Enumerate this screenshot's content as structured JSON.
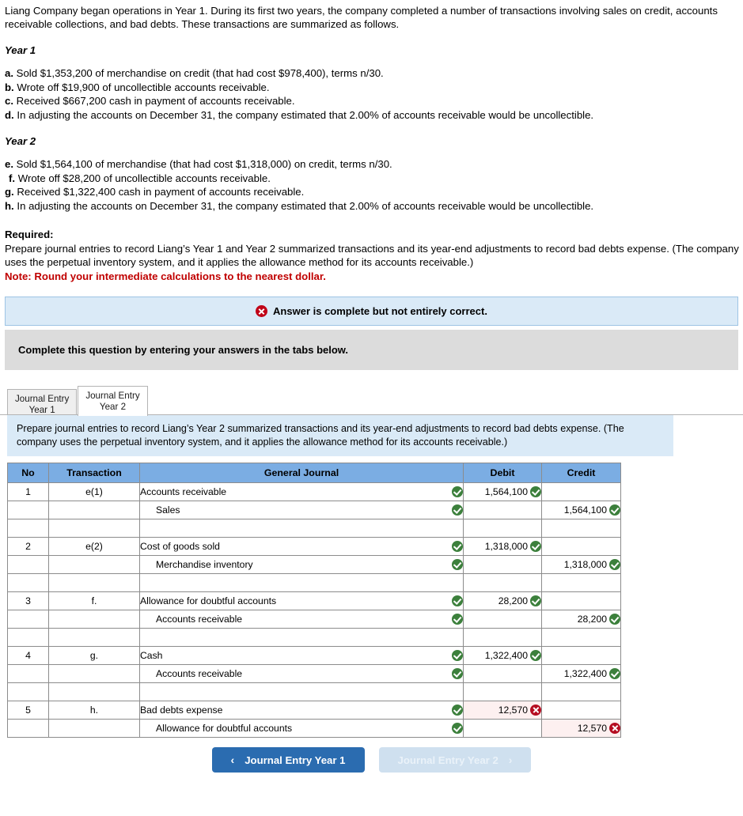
{
  "problem": {
    "intro": "Liang Company began operations in Year 1. During its first two years, the company completed a number of transactions involving sales on credit, accounts receivable collections, and bad debts. These transactions are summarized as follows.",
    "year1_heading": "Year 1",
    "year1_items": [
      {
        "label": "a.",
        "text": "Sold $1,353,200 of merchandise on credit (that had cost $978,400), terms n/30."
      },
      {
        "label": "b.",
        "text": "Wrote off $19,900 of uncollectible accounts receivable."
      },
      {
        "label": "c.",
        "text": "Received $667,200 cash in payment of accounts receivable."
      },
      {
        "label": "d.",
        "text": "In adjusting the accounts on December 31, the company estimated that 2.00% of accounts receivable would be uncollectible."
      }
    ],
    "year2_heading": "Year 2",
    "year2_items": [
      {
        "label": "e.",
        "text": "Sold $1,564,100 of merchandise (that had cost $1,318,000) on credit, terms n/30."
      },
      {
        "label": "f.",
        "text": "Wrote off $28,200 of uncollectible accounts receivable."
      },
      {
        "label": "g.",
        "text": "Received $1,322,400 cash in payment of accounts receivable."
      },
      {
        "label": "h.",
        "text": "In adjusting the accounts on December 31, the company estimated that 2.00% of accounts receivable would be uncollectible."
      }
    ],
    "required_title": "Required:",
    "required_text": "Prepare journal entries to record Liang’s Year 1 and Year 2 summarized transactions and its year-end adjustments to record bad debts expense. (The company uses the perpetual inventory system, and it applies the allowance method for its accounts receivable.)",
    "note": "Note: Round your intermediate calculations to the nearest dollar."
  },
  "status": {
    "icon": "x-circle-icon",
    "message": "Answer is complete but not entirely correct.",
    "banner_bg": "#daeaf7",
    "icon_color": "#c00418"
  },
  "instruction_bar": {
    "text": "Complete this question by entering your answers in the tabs below."
  },
  "tabs": [
    {
      "label": "Journal Entry\nYear 1",
      "active": false
    },
    {
      "label": "Journal Entry\nYear 2",
      "active": true
    }
  ],
  "panel": {
    "text": "Prepare journal entries to record Liang’s Year 2 summarized transactions and its year-end adjustments to record bad debts expense. (The company uses the perpetual inventory system, and it applies the allowance method for its accounts receivable.)"
  },
  "table": {
    "headers": [
      "No",
      "Transaction",
      "General Journal",
      "Debit",
      "Credit"
    ],
    "header_bg": "#7badE3",
    "rows": [
      {
        "no": "1",
        "transaction": "e(1)",
        "account": "Accounts receivable",
        "indent": false,
        "account_mark": "ok",
        "debit": "1,564,100",
        "debit_mark": "ok",
        "credit": "",
        "credit_mark": ""
      },
      {
        "no": "",
        "transaction": "",
        "account": "Sales",
        "indent": true,
        "account_mark": "ok",
        "debit": "",
        "debit_mark": "",
        "credit": "1,564,100",
        "credit_mark": "ok"
      },
      {
        "spacer": true
      },
      {
        "no": "2",
        "transaction": "e(2)",
        "account": "Cost of goods sold",
        "indent": false,
        "account_mark": "ok",
        "debit": "1,318,000",
        "debit_mark": "ok",
        "credit": "",
        "credit_mark": ""
      },
      {
        "no": "",
        "transaction": "",
        "account": "Merchandise inventory",
        "indent": true,
        "account_mark": "ok",
        "debit": "",
        "debit_mark": "",
        "credit": "1,318,000",
        "credit_mark": "ok"
      },
      {
        "spacer": true
      },
      {
        "no": "3",
        "transaction": "f.",
        "account": "Allowance for doubtful accounts",
        "indent": false,
        "account_mark": "ok",
        "debit": "28,200",
        "debit_mark": "ok",
        "credit": "",
        "credit_mark": ""
      },
      {
        "no": "",
        "transaction": "",
        "account": "Accounts receivable",
        "indent": true,
        "account_mark": "ok",
        "debit": "",
        "debit_mark": "",
        "credit": "28,200",
        "credit_mark": "ok"
      },
      {
        "spacer": true
      },
      {
        "no": "4",
        "transaction": "g.",
        "account": "Cash",
        "indent": false,
        "account_mark": "ok",
        "debit": "1,322,400",
        "debit_mark": "ok",
        "credit": "",
        "credit_mark": ""
      },
      {
        "no": "",
        "transaction": "",
        "account": "Accounts receivable",
        "indent": true,
        "account_mark": "ok",
        "debit": "",
        "debit_mark": "",
        "credit": "1,322,400",
        "credit_mark": "ok"
      },
      {
        "spacer": true
      },
      {
        "no": "5",
        "transaction": "h.",
        "account": "Bad debts expense",
        "indent": false,
        "account_mark": "ok",
        "debit": "12,570",
        "debit_mark": "bad",
        "credit": "",
        "credit_mark": ""
      },
      {
        "no": "",
        "transaction": "",
        "account": "Allowance for doubtful accounts",
        "indent": true,
        "account_mark": "ok",
        "debit": "",
        "debit_mark": "",
        "credit": "12,570",
        "credit_mark": "bad"
      }
    ]
  },
  "nav": {
    "prev_label": "Journal Entry Year 1",
    "prev_chevron": "‹",
    "next_label": "Journal Entry Year 2",
    "next_chevron": "›",
    "prev_color": "#2b6cb0",
    "next_color": "#cfe0ef"
  }
}
